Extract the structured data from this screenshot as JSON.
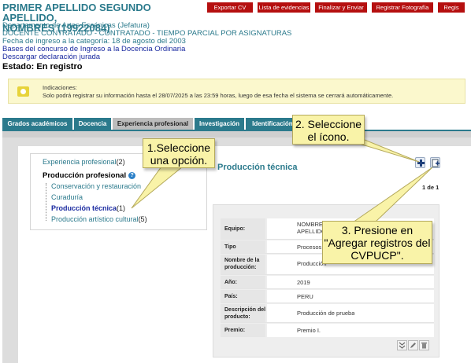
{
  "header": {
    "name_line1": "PRIMER APELLIDO SEGUNDO APELLIDO,",
    "name_line2": "NOMBRES (19922084)",
    "department": "Departamento de Artes Escénicas (Jefatura)",
    "position": "DOCENTE CONTRATADO - CONTRATADO - TIEMPO PARCIAL POR ASIGNATURAS",
    "category_date": "Fecha de ingreso a la categoría: 18 de agosto del 2003",
    "link_bases": "Bases del concurso de Ingreso a la Docencia Ordinaria",
    "link_download": "Descargar declaración jurada",
    "status_label": "Estado:",
    "status_value": "En registro"
  },
  "toolbar": {
    "export_cv": "Exportar CV",
    "evidence_list": "Lista de evidencias",
    "finish_send": "Finalizar y Enviar",
    "register_photo": "Registrar Fotografía",
    "register_more": "Regis"
  },
  "alert": {
    "title": "Indicaciones:",
    "message": "Solo podrá registrar su información hasta el 28/07/2025 a las 23:59 horas, luego de esa fecha el sistema se cerrará automáticamente."
  },
  "tabs": [
    {
      "label": "Grados académicos"
    },
    {
      "label": "Docencia"
    },
    {
      "label": "Experiencia profesional"
    },
    {
      "label": "Investigación"
    },
    {
      "label": "Identificación,"
    }
  ],
  "sidebar": {
    "experience": {
      "label": "Experiencia profesional",
      "count": "(2)"
    },
    "production": {
      "label": "Producción profesional"
    },
    "items": [
      {
        "label": "Conservación y restauración",
        "count": ""
      },
      {
        "label": "Curaduría",
        "count": ""
      },
      {
        "label": "Producción técnica",
        "count": "(1)"
      },
      {
        "label": "Producción artístico cultural",
        "count": "(5)"
      }
    ]
  },
  "main": {
    "section_title": "Producción técnica",
    "pager": "1 de 1"
  },
  "record": {
    "rows": [
      {
        "key": "Equipo:",
        "value": "NOMBRES APELLIDO"
      },
      {
        "key": "Tipo",
        "value": "Procesos"
      },
      {
        "key": "Nombre de la producción:",
        "value": "Producción"
      },
      {
        "key": "Año:",
        "value": "2019"
      },
      {
        "key": "País:",
        "value": "PERU"
      },
      {
        "key": "Descripción del producto:",
        "value": "Producción de prueba"
      },
      {
        "key": "Premio:",
        "value": "Premio I."
      }
    ]
  },
  "callouts": {
    "step1": {
      "line1": "1.Seleccione",
      "line2": "una opción."
    },
    "step2": {
      "line1": "2. Seleccione",
      "line2": "el ícono."
    },
    "step3": {
      "line1": "3. Presione en",
      "line2": "\"Agregar registros del",
      "line3": "CVPUCP\"."
    }
  },
  "icons": {
    "add": "plus-icon",
    "add_cvpucp": "add-records-icon",
    "expand": "chevron-double-down-icon",
    "edit": "pencil-icon",
    "delete": "trash-icon",
    "help": "help-icon",
    "info": "info-icon"
  },
  "colors": {
    "brand_teal": "#2b7a8c",
    "button_red": "#b50f0f",
    "link_navy": "#1a2aa0",
    "alert_bg": "#fbf8cd",
    "callout_bg": "#f9f3a8"
  }
}
